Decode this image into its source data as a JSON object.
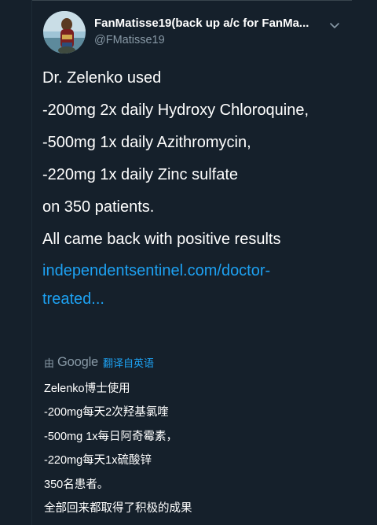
{
  "tweet": {
    "author": {
      "display_name": "FanMatisse19(back up a/c for FanMa...",
      "handle": "@FMatisse19",
      "avatar_icon": "avatar-photo-icon"
    },
    "menu_icon": "chevron-down-icon",
    "body_lines": [
      "Dr. Zelenko used",
      "-200mg 2x daily Hydroxy Chloroquine,",
      "-500mg 1x daily Azithromycin,",
      "-220mg 1x daily Zinc sulfate",
      "on 350 patients.",
      "All came back with positive  results"
    ],
    "link_lines": [
      "independentsentinel.com/doctor-",
      "treated..."
    ]
  },
  "translation": {
    "by_label": "由",
    "provider": "Google",
    "translated_from": "翻译自英语",
    "lines": [
      "Zelenko博士使用",
      " -200mg每天2次羟基氯喹",
      " -500mg 1x每日阿奇霉素，",
      " -220mg每天1x硫酸锌",
      " 350名患者。",
      "全部回来都取得了积极的成果"
    ]
  },
  "colors": {
    "background": "#15202b",
    "text": "#ffffff",
    "secondary_text": "#8899a6",
    "link": "#1da1f2"
  }
}
